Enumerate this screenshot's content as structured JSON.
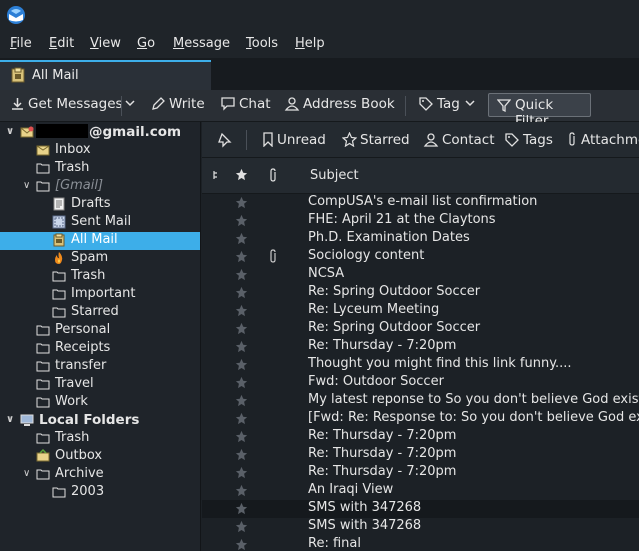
{
  "menu": {
    "items": [
      {
        "pre": "",
        "u": "F",
        "post": "ile"
      },
      {
        "pre": "",
        "u": "E",
        "post": "dit"
      },
      {
        "pre": "",
        "u": "V",
        "post": "iew"
      },
      {
        "pre": "",
        "u": "G",
        "post": "o"
      },
      {
        "pre": "",
        "u": "M",
        "post": "essage"
      },
      {
        "pre": "",
        "u": "T",
        "post": "ools"
      },
      {
        "pre": "",
        "u": "H",
        "post": "elp"
      }
    ]
  },
  "tab": {
    "label": "All Mail"
  },
  "toolbar": {
    "get_messages": "Get Messages",
    "write": "Write",
    "chat": "Chat",
    "address_book": "Address Book",
    "tag": "Tag",
    "quick_filter": "Quick Filter"
  },
  "quick_filter_bar": {
    "unread": "Unread",
    "starred": "Starred",
    "contact": "Contact",
    "tags": "Tags",
    "attachment": "Attachme"
  },
  "columns": {
    "subject": "Subject"
  },
  "account": {
    "email_suffix": "@gmail.com"
  },
  "folders": {
    "inbox": "Inbox",
    "trash": "Trash",
    "gmail": "[Gmail]",
    "drafts": "Drafts",
    "sent_mail": "Sent Mail",
    "all_mail": "All Mail",
    "spam": "Spam",
    "gmail_trash": "Trash",
    "important": "Important",
    "starred": "Starred",
    "personal": "Personal",
    "receipts": "Receipts",
    "transfer": "transfer",
    "travel": "Travel",
    "work": "Work",
    "local_folders": "Local Folders",
    "local_trash": "Trash",
    "outbox": "Outbox",
    "archive": "Archive",
    "year_2003": "2003"
  },
  "messages": [
    {
      "subject": "CompUSA's e-mail list confirmation",
      "attachment": false
    },
    {
      "subject": "FHE: April 21 at the Claytons",
      "attachment": false
    },
    {
      "subject": "Ph.D. Examination Dates",
      "attachment": false
    },
    {
      "subject": "Sociology content",
      "attachment": true
    },
    {
      "subject": "NCSA",
      "attachment": false
    },
    {
      "subject": "Re: Spring Outdoor Soccer",
      "attachment": false
    },
    {
      "subject": "Re: Lyceum Meeting",
      "attachment": false
    },
    {
      "subject": "Re: Spring Outdoor Soccer",
      "attachment": false
    },
    {
      "subject": "Re: Thursday -  7:20pm",
      "attachment": false
    },
    {
      "subject": "Thought you might find this link funny....",
      "attachment": false
    },
    {
      "subject": "Fwd: Outdoor Soccer",
      "attachment": false
    },
    {
      "subject": "My latest reponse to So you don't believe God exists",
      "attachment": false
    },
    {
      "subject": "[Fwd: Re: Response to: So you don't believe God exists",
      "attachment": false
    },
    {
      "subject": "Re: Thursday -  7:20pm",
      "attachment": false
    },
    {
      "subject": "Re: Thursday -  7:20pm",
      "attachment": false
    },
    {
      "subject": "Re: Thursday -  7:20pm",
      "attachment": false
    },
    {
      "subject": "An Iraqi View",
      "attachment": false
    },
    {
      "subject": "SMS with 347268",
      "attachment": false
    },
    {
      "subject": "SMS with 347268",
      "attachment": false
    },
    {
      "subject": "Re: final",
      "attachment": false
    }
  ],
  "colors": {
    "accent": "#3daee9",
    "background": "#1c2126"
  }
}
